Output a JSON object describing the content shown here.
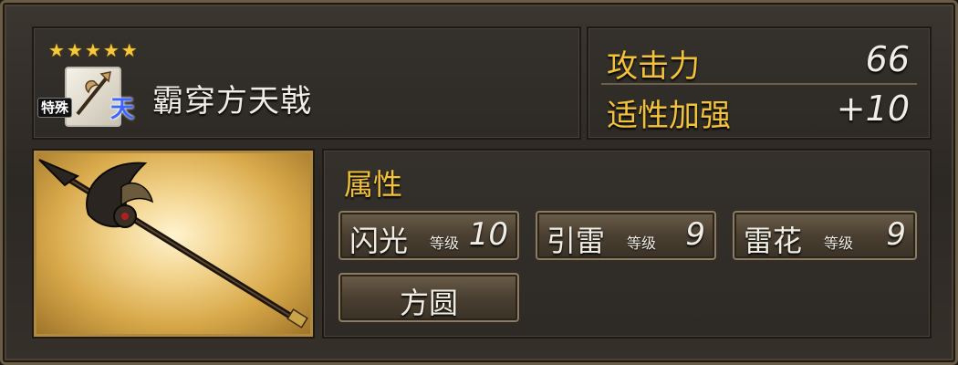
{
  "weapon": {
    "stars": [
      "★",
      "★",
      "★",
      "★",
      "★"
    ],
    "type_tag": "特殊",
    "rank_tag": "天",
    "name": "霸穿方天戟",
    "icon": "halberd-icon"
  },
  "stats": [
    {
      "label": "攻击力",
      "value": "66"
    },
    {
      "label": "适性加强",
      "value": "+10"
    }
  ],
  "attributes": {
    "title": "属性",
    "level_label": "等级",
    "items": [
      {
        "name": "闪光",
        "level": "10"
      },
      {
        "name": "引雷",
        "level": "9"
      },
      {
        "name": "雷花",
        "level": "9"
      },
      {
        "name": "方圆"
      }
    ]
  },
  "colors": {
    "accent_gold": "#f2c23a",
    "text_light": "#f0ede4",
    "rank_blue": "#3d66ff"
  }
}
